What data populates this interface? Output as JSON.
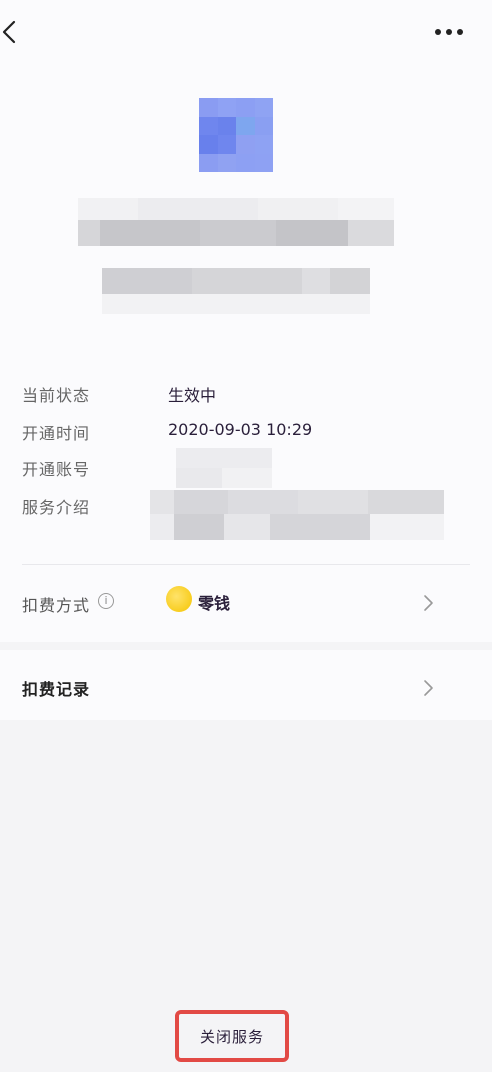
{
  "info": {
    "status_label": "当前状态",
    "status_value": "生效中",
    "open_time_label": "开通时间",
    "open_time_value": "2020-09-03 10:29",
    "account_label": "开通账号",
    "intro_label": "服务介绍"
  },
  "payment": {
    "label": "扣费方式",
    "info_icon": "i",
    "method": "零钱",
    "method_icon": "coin-icon"
  },
  "records": {
    "label": "扣费记录"
  },
  "footer": {
    "close_button": "关闭服务"
  },
  "colors": {
    "logo_blue": "#6f86ee",
    "highlight_border": "#e24a45",
    "coin": "#f5c400"
  }
}
